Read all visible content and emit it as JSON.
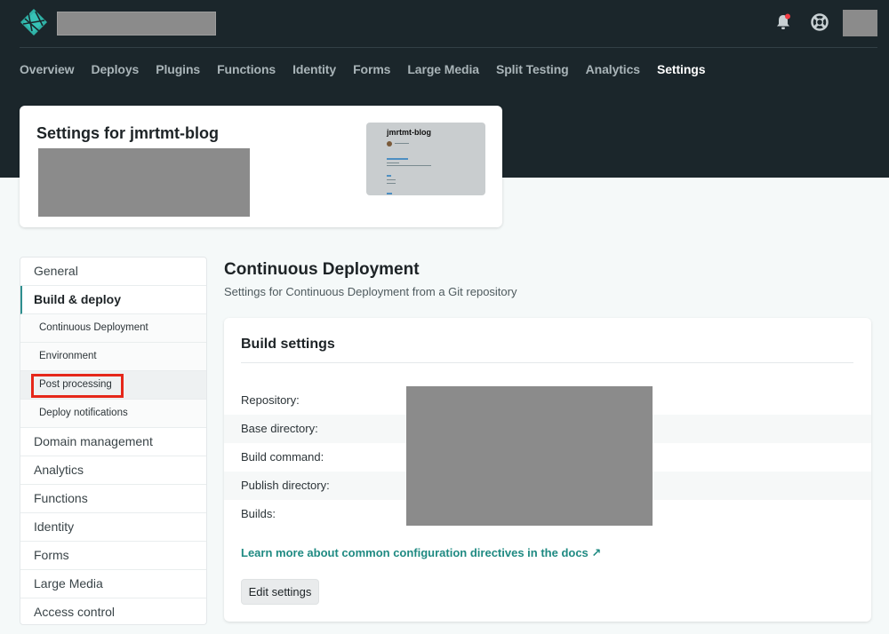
{
  "header": {
    "nav": [
      {
        "label": "Overview"
      },
      {
        "label": "Deploys"
      },
      {
        "label": "Plugins"
      },
      {
        "label": "Functions"
      },
      {
        "label": "Identity"
      },
      {
        "label": "Forms"
      },
      {
        "label": "Large Media"
      },
      {
        "label": "Split Testing"
      },
      {
        "label": "Analytics"
      },
      {
        "label": "Settings",
        "active": true
      }
    ],
    "icons": {
      "logo": "netlify-logo-icon",
      "notifications": "bell-icon",
      "help": "lifebuoy-icon"
    }
  },
  "site_card": {
    "title": "Settings for jmrtmt-blog",
    "preview_title": "jmrtmt-blog"
  },
  "sidebar": {
    "items": [
      {
        "label": "General"
      },
      {
        "label": "Build & deploy",
        "current": true,
        "sub": [
          {
            "label": "Continuous Deployment"
          },
          {
            "label": "Environment"
          },
          {
            "label": "Post processing",
            "highlighted": true
          },
          {
            "label": "Deploy notifications"
          }
        ]
      },
      {
        "label": "Domain management"
      },
      {
        "label": "Analytics"
      },
      {
        "label": "Functions"
      },
      {
        "label": "Identity"
      },
      {
        "label": "Forms"
      },
      {
        "label": "Large Media"
      },
      {
        "label": "Access control"
      }
    ]
  },
  "content": {
    "title": "Continuous Deployment",
    "subtitle": "Settings for Continuous Deployment from a Git repository",
    "panel": {
      "title": "Build settings",
      "rows": [
        {
          "label": "Repository:"
        },
        {
          "label": "Base directory:"
        },
        {
          "label": "Build command:"
        },
        {
          "label": "Publish directory:"
        },
        {
          "label": "Builds:"
        }
      ],
      "docs_link": "Learn more about common configuration directives in the docs ↗",
      "edit_button": "Edit settings"
    }
  },
  "colors": {
    "header_bg": "#1b262b",
    "accent": "#1f8a82",
    "highlight_box": "#e5271a"
  }
}
